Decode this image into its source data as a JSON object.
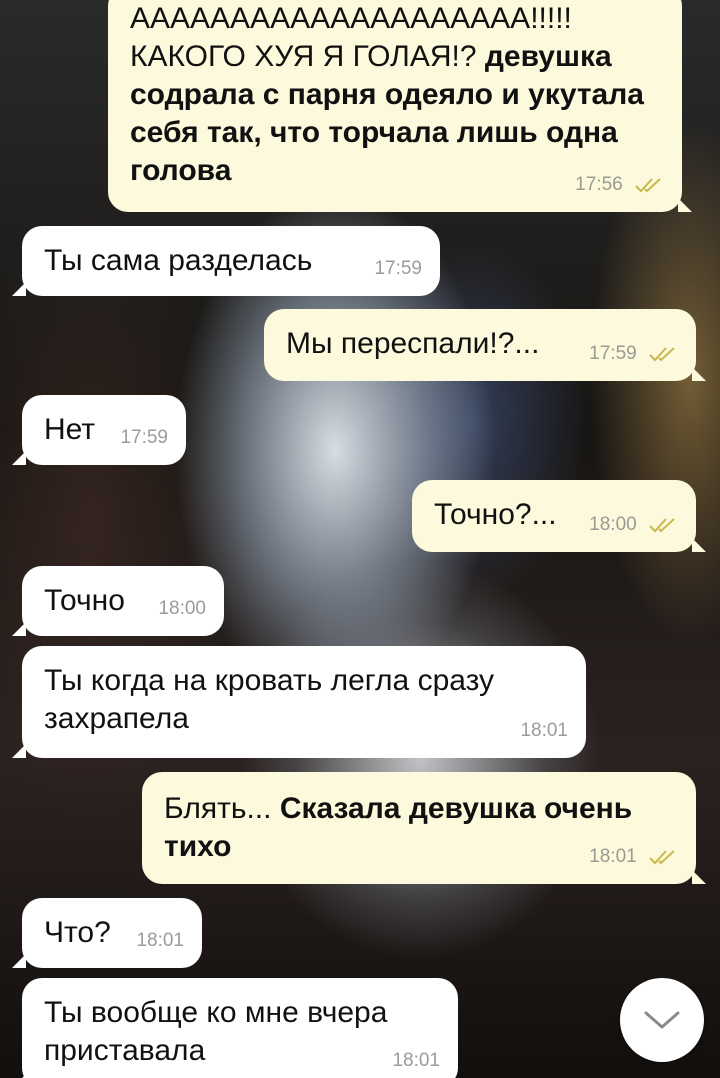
{
  "messages": [
    {
      "id": "m1",
      "dir": "out",
      "text_plain": "АААААААААААААААААААА!!!!! КАКОГО ХУЯ Я ГОЛАЯ!? ",
      "text_bold": "девушка содрала с парня одеяло и укутала себя так, что торчала лишь одна голова",
      "time": "17:56",
      "read": true
    },
    {
      "id": "m2",
      "dir": "in",
      "text_plain": "Ты сама разделась",
      "time": "17:59"
    },
    {
      "id": "m3",
      "dir": "out",
      "text_plain": "Мы переспали!?...",
      "time": "17:59",
      "read": true
    },
    {
      "id": "m4",
      "dir": "in",
      "text_plain": "Нет",
      "time": "17:59"
    },
    {
      "id": "m5",
      "dir": "out",
      "text_plain": "Точно?...",
      "time": "18:00",
      "read": true
    },
    {
      "id": "m6",
      "dir": "in",
      "text_plain": "Точно",
      "time": "18:00"
    },
    {
      "id": "m7",
      "dir": "in",
      "text_plain": "Ты когда на кровать легла сразу захрапела",
      "time": "18:01"
    },
    {
      "id": "m8",
      "dir": "out",
      "text_plain": "Блять... ",
      "text_bold": "Сказала девушка очень тихо",
      "time": "18:01",
      "read": true
    },
    {
      "id": "m9",
      "dir": "in",
      "text_plain": "Что?",
      "time": "18:01"
    },
    {
      "id": "m10",
      "dir": "in",
      "text_plain": "Ты вообще ко мне вчера приставала",
      "time": "18:01"
    }
  ],
  "scroll_button": {
    "icon": "chevron-down-icon"
  },
  "colors": {
    "incoming_bubble": "#ffffff",
    "outgoing_bubble": "#fdf9dc",
    "read_check": "#c9b84c",
    "meta_text": "#9b9a93"
  }
}
